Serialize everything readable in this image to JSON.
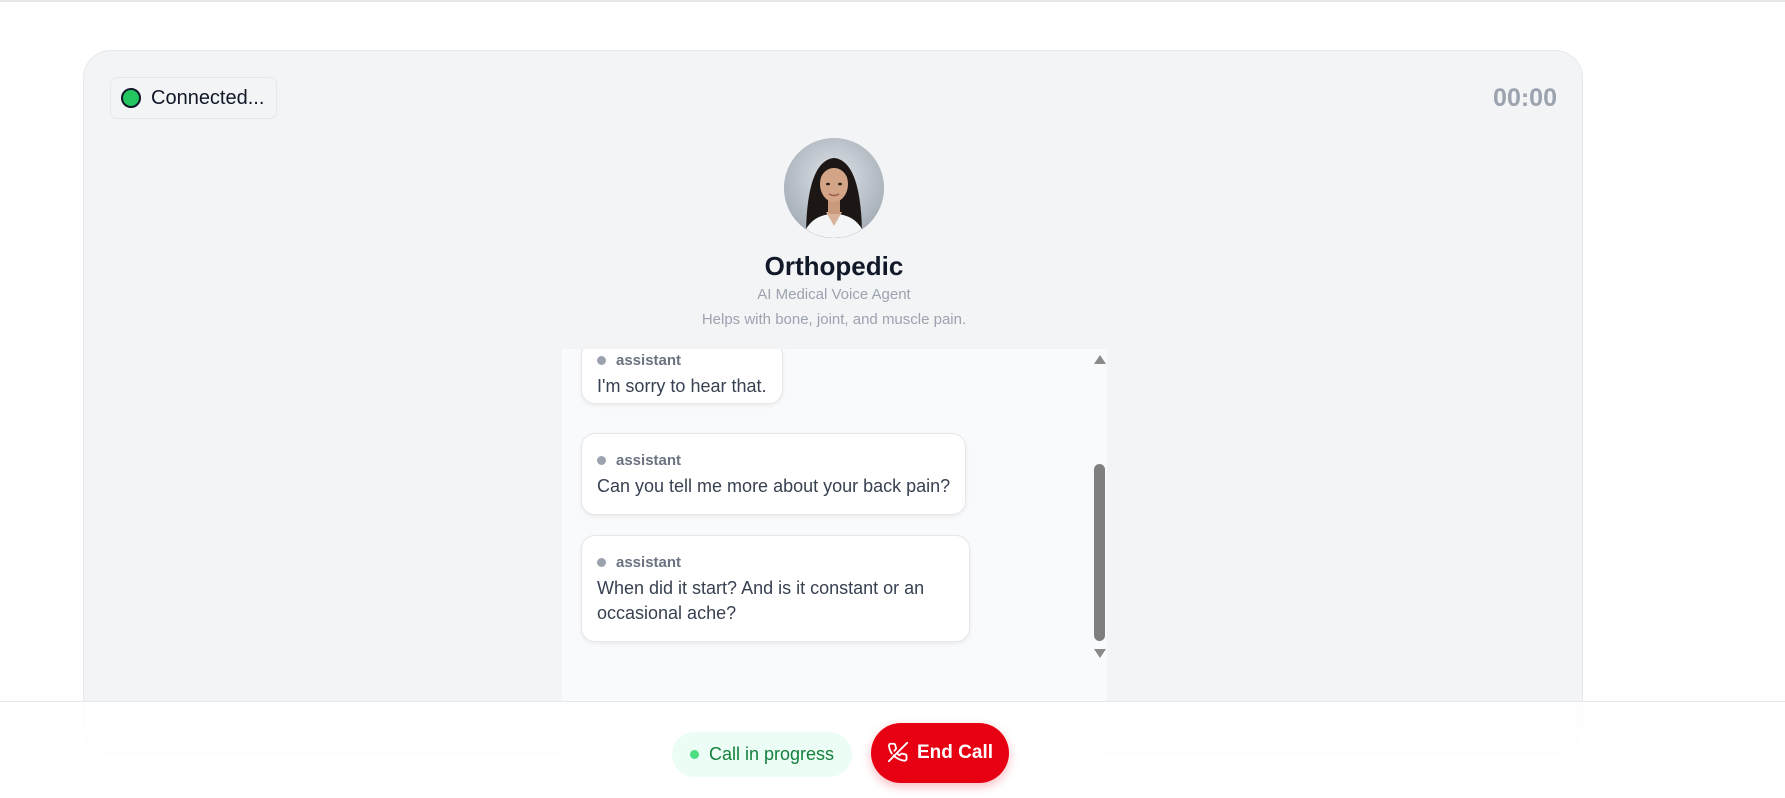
{
  "header": {
    "status_label": "Connected...",
    "timer": "00:00"
  },
  "agent": {
    "name": "Orthopedic",
    "role": "AI Medical Voice Agent",
    "description": "Helps with bone, joint, and muscle pain."
  },
  "transcript": {
    "messages": [
      {
        "role": "assistant",
        "text": "I'm sorry to hear that."
      },
      {
        "role": "assistant",
        "text": "Can you tell me more about your back pain?"
      },
      {
        "role": "assistant",
        "text": "When did it start? And is it constant or an occasional ache?"
      }
    ]
  },
  "footer": {
    "call_status": "Call in progress",
    "end_call_label": "End Call"
  },
  "colors": {
    "connected": "#22c55e",
    "end_call": "#e60012",
    "progress_text": "#15803d"
  },
  "icons": {
    "status": "status-dot-icon",
    "end_call": "phone-off-icon"
  }
}
